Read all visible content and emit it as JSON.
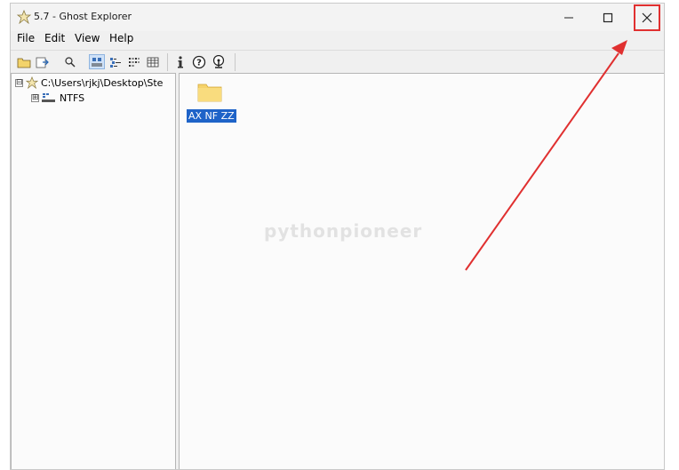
{
  "window": {
    "title": "5.7 - Ghost Explorer",
    "controls": {
      "minimize": "—",
      "maximize": "☐",
      "close": "✕"
    }
  },
  "menu": [
    "File",
    "Edit",
    "View",
    "Help"
  ],
  "toolbar": {
    "icons": [
      "open-folder-icon",
      "export-icon",
      "search-icon",
      "large-icons-view-icon",
      "small-icons-view-icon",
      "list-view-icon",
      "details-view-icon",
      "info-icon",
      "help-icon",
      "network-icon"
    ],
    "active": "large-icons-view-icon"
  },
  "tree": {
    "root": {
      "label": "C:\\Users\\rjkj\\Desktop\\Ste",
      "expander": "⊟"
    },
    "child": {
      "label": "NTFS",
      "expander": "⊞"
    }
  },
  "files": [
    {
      "name": "AX NF ZZ",
      "selected": true
    }
  ],
  "watermark": "pythonpioneer",
  "colors": {
    "selection": "#1e63c8",
    "annotation_arrow": "#e03030",
    "folder": "#f6d36b"
  }
}
